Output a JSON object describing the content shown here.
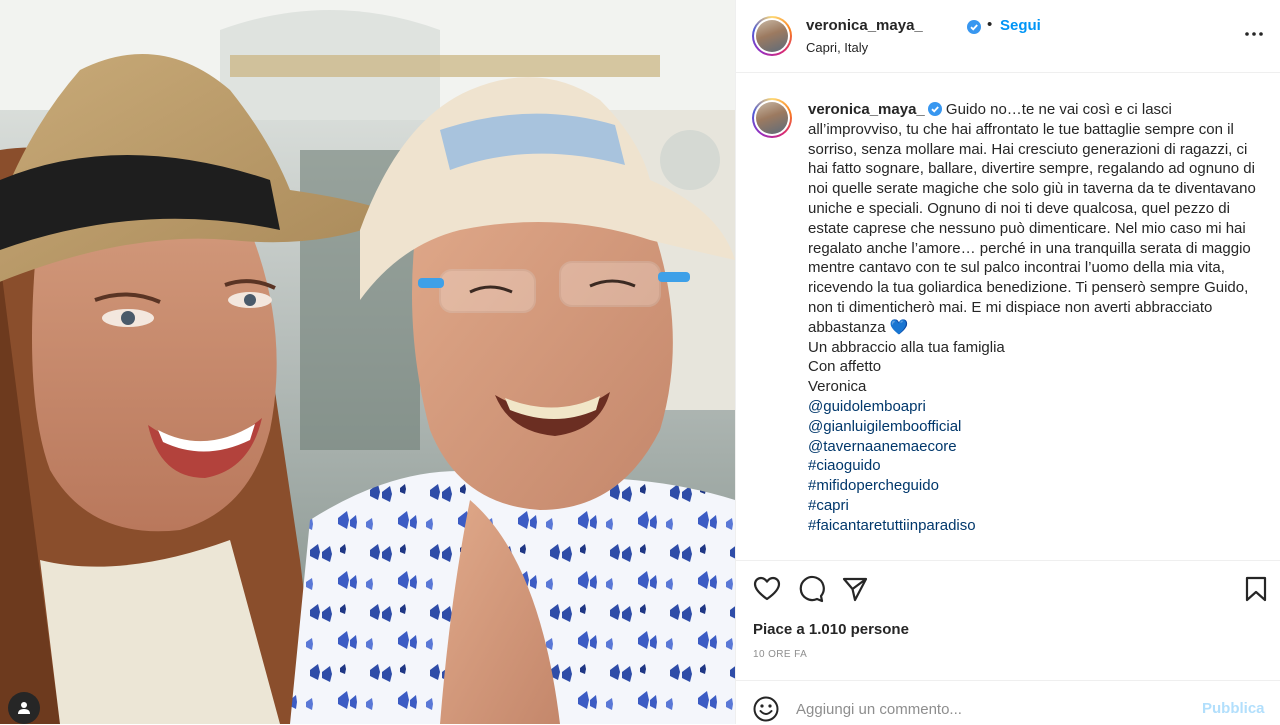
{
  "post": {
    "username": "veronica_maya_",
    "follow_label": "Segui",
    "separator": "•",
    "location": "Capri, Italy",
    "colors": {
      "accent": "#0095f6",
      "verified": "#3897f0",
      "link": "#00376b",
      "muted": "#8e8e8e"
    }
  },
  "caption": {
    "username": "veronica_maya_",
    "lines": [
      "Guido no…te ne vai così e ci lasci all’improvviso, tu che hai affrontato le tue battaglie sempre con il sorriso, senza mollare mai. Hai cresciuto generazioni di ragazzi, ci hai fatto sognare, ballare, divertire sempre, regalando ad ognuno di noi quelle serate magiche che solo giù in taverna da te diventavano uniche e speciali. Ognuno di noi ti deve qualcosa, quel pezzo di estate caprese che nessuno può dimenticare. Nel mio caso mi hai regalato anche l’amore… perché in una tranquilla serata di maggio mentre cantavo con te sul palco incontrai l’uomo della mia vita, ricevendo la tua goliardica benedizione. Ti penserò sempre Guido, non ti dimenticherò mai. E mi dispiace non averti abbracciato abbastanza 💙",
      "Un abbraccio alla tua famiglia",
      "Con affetto",
      "Veronica"
    ],
    "tags": [
      "@guidolemboapri",
      "@gianluigilemboofficial",
      "@tavernaanemaecore",
      "#ciaoguido",
      "#mifidopercheguido",
      "#capri",
      "#faicantaretuttiinparadiso"
    ]
  },
  "actions": {
    "likes_text": "Piace a 1.010 persone",
    "time_text": "10 ORE FA",
    "icons": [
      "heart-icon",
      "comment-icon",
      "share-icon",
      "bookmark-icon"
    ]
  },
  "comment": {
    "placeholder": "Aggiungi un commento...",
    "publish_label": "Pubblica"
  }
}
